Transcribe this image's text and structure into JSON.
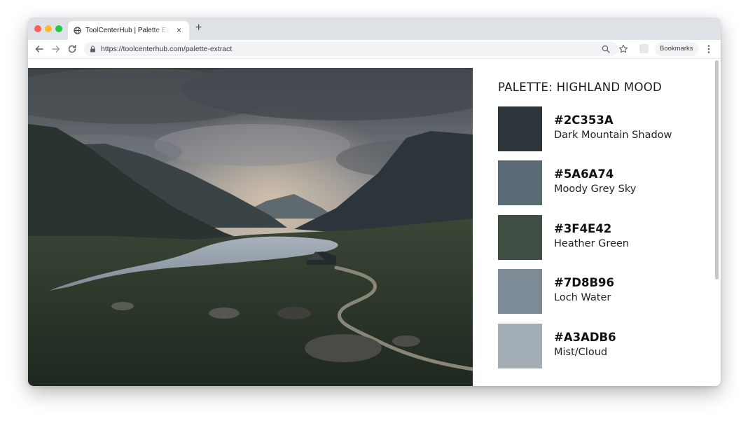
{
  "browser": {
    "tab_title": "ToolCenterHub | Palette Extractor",
    "tab_close": "×",
    "new_tab": "+",
    "url": "https://toolcenterhub.com/palette-extract",
    "bookmarks_label": "Bookmarks",
    "icons": [
      "globe-icon",
      "close-icon",
      "plus-icon",
      "back-arrow-icon",
      "forward-arrow-icon",
      "reload-icon",
      "lock-icon",
      "zoom-icon",
      "star-icon",
      "extension-icon",
      "kebab-menu-icon"
    ]
  },
  "palette": {
    "title": "PALETTE: HIGHLAND MOOD",
    "swatches": [
      {
        "hex": "#2C353A",
        "name": "Dark Mountain Shadow",
        "color": "#2C353A"
      },
      {
        "hex": "#5A6A74",
        "name": "Moody Grey Sky",
        "color": "#5A6A74"
      },
      {
        "hex": "#3F4E42",
        "name": "Heather Green",
        "color": "#3F4E42"
      },
      {
        "hex": "#7D8B96",
        "name": "Loch Water",
        "color": "#7D8B96"
      },
      {
        "hex": "#A3ADB6",
        "name": "Mist/Cloud",
        "color": "#A3ADB6"
      }
    ]
  }
}
